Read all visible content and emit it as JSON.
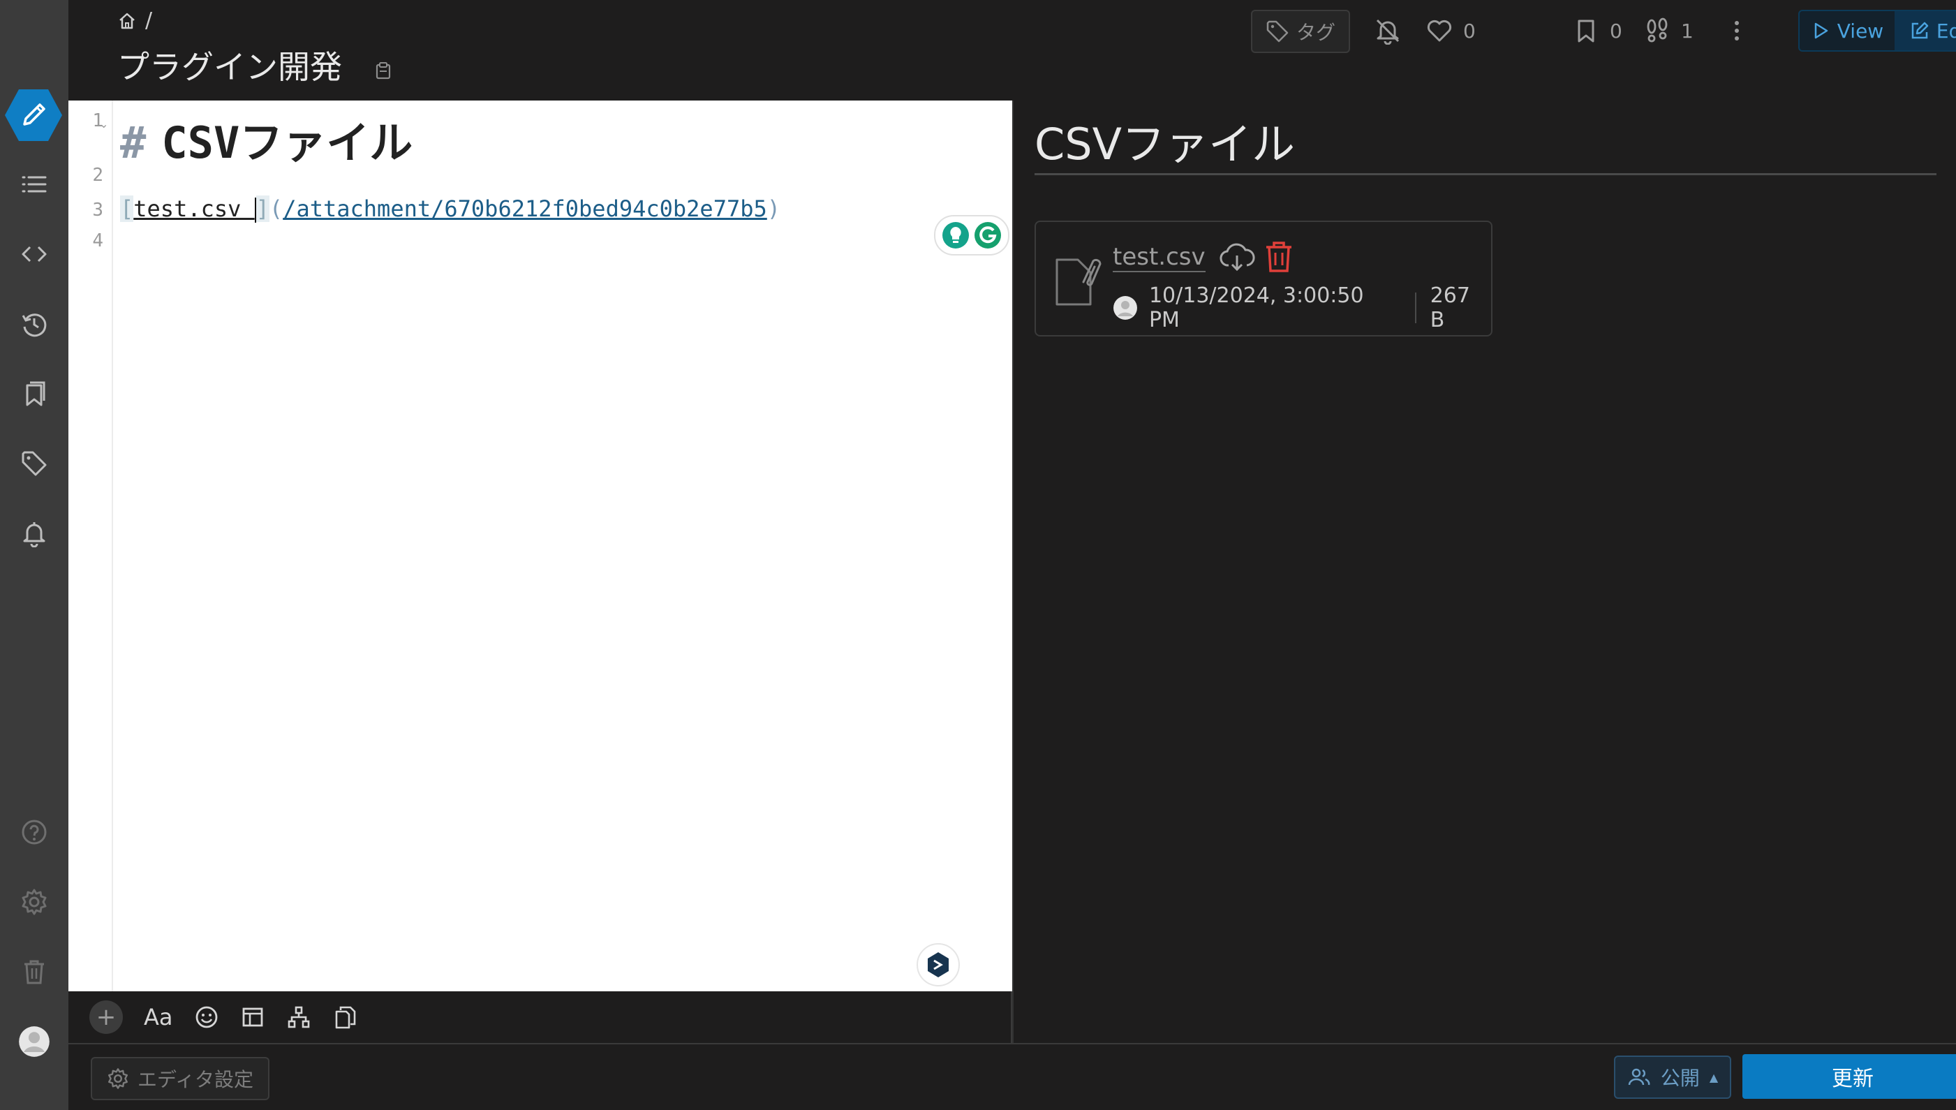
{
  "breadcrumb": {
    "separator": "/"
  },
  "page": {
    "title": "プラグイン開発"
  },
  "header": {
    "tag_label": "タグ",
    "like_count": "0",
    "bookmark_count": "0",
    "seen_count": "1",
    "view_label": "View",
    "edit_label": "Edit"
  },
  "editor": {
    "line_numbers": [
      "1",
      "2",
      "3",
      "4"
    ],
    "heading_hash": "#",
    "heading_text": "CSVファイル",
    "link_open": "[",
    "link_text": "test.csv ",
    "link_close": "]",
    "paren_open": "(",
    "link_url": "/attachment/670b6212f0bed94c0b2e77b5",
    "paren_close": ")"
  },
  "toolbar": {
    "plus": "+",
    "font": "Aa"
  },
  "preview": {
    "heading": "CSVファイル",
    "attachment": {
      "name": "test.csv",
      "date": "10/13/2024, 3:00:50 PM",
      "size": "267 B"
    }
  },
  "footer": {
    "editor_settings": "エディタ設定",
    "public_label": "公開",
    "update_label": "更新"
  },
  "icons": {
    "sidebar": [
      "pencil-icon",
      "list-icon",
      "code-icon",
      "history-icon",
      "bookmarks-icon",
      "tag-icon",
      "bell-icon",
      "help-icon",
      "gear-icon",
      "trash-icon",
      "avatar"
    ],
    "header": [
      "home-icon",
      "clipboard-icon",
      "tag-icon",
      "bell-off-icon",
      "heart-icon",
      "bookmark-icon",
      "footprints-icon",
      "kebab-icon",
      "play-icon",
      "edit-icon"
    ]
  },
  "colors": {
    "accent": "#0a7bc2",
    "sidebar_bg": "#3b3b3b",
    "app_bg": "#1e1d1d",
    "editor_bg": "#ffffff",
    "delete_red": "#e0403a"
  }
}
